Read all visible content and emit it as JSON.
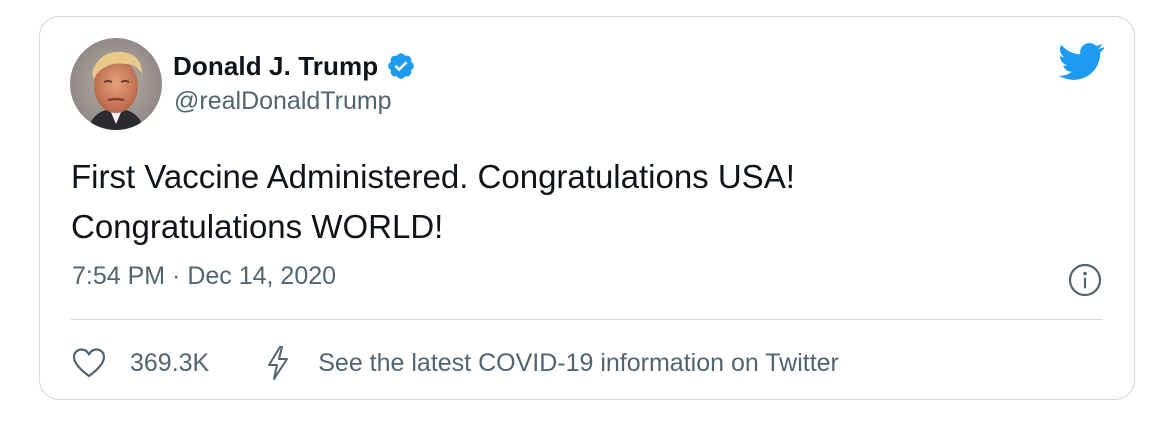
{
  "tweet": {
    "author": {
      "display_name": "Donald J. Trump",
      "handle": "@realDonaldTrump",
      "verified": true,
      "avatar_icon": "profile-photo"
    },
    "text_lines": [
      "First Vaccine Administered. Congratulations USA!",
      "Congratulations WORLD!"
    ],
    "timestamp": "7:54 PM · Dec 14, 2020",
    "likes": {
      "icon": "heart-icon",
      "count": "369.3K"
    },
    "covid_info": {
      "icon": "bolt-icon",
      "label": "See the latest COVID-19 information on Twitter"
    },
    "brand_icon": "twitter-bird-icon",
    "info_icon": "info-icon"
  },
  "colors": {
    "brand_blue": "#1d9bf0",
    "text_primary": "#0f1419",
    "text_secondary": "#536471",
    "border": "#cfd9de"
  }
}
